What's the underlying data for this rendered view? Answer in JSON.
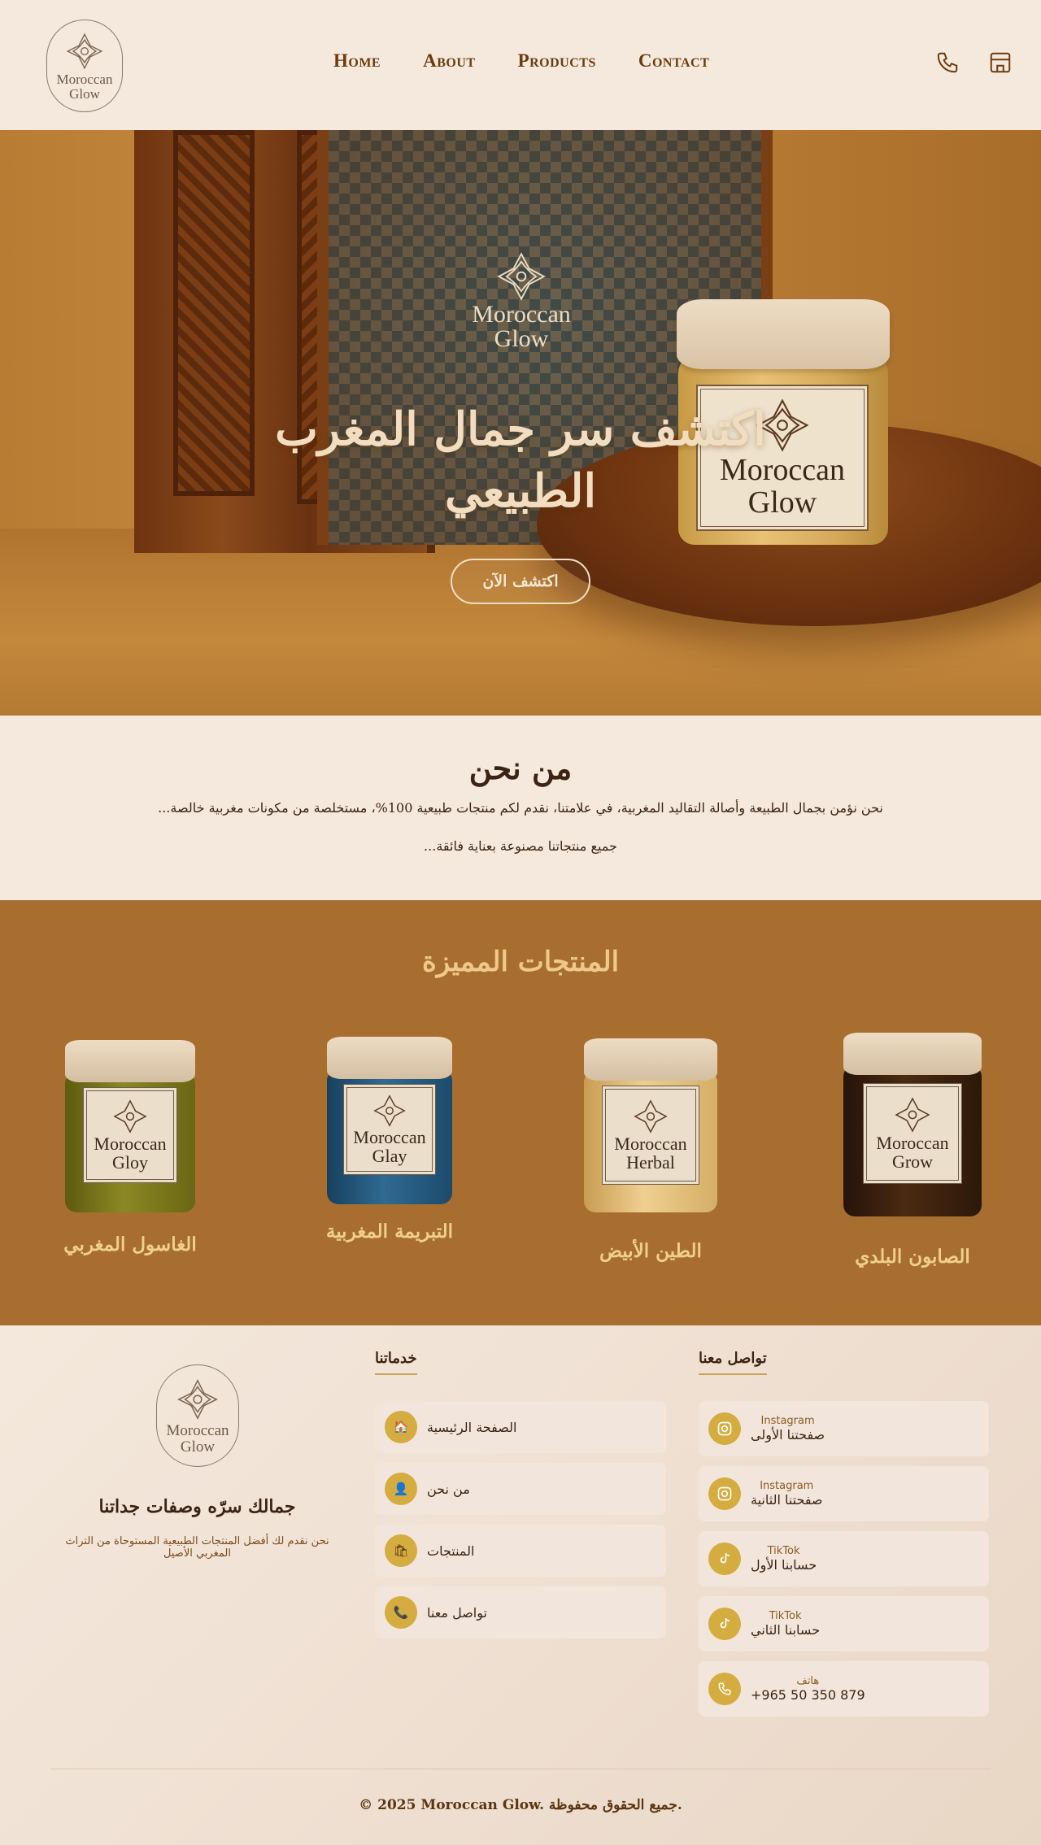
{
  "brand": {
    "name_line1": "Moroccan",
    "name_line2": "Glow"
  },
  "nav": {
    "items": [
      "Home",
      "About",
      "Products",
      "Contact"
    ]
  },
  "header_icons": [
    "phone-icon",
    "store-icon"
  ],
  "hero": {
    "logo_line1": "Moroccan",
    "logo_line2": "Glow",
    "jar_label_line1": "Moroccan",
    "jar_label_line2": "Glow",
    "title": "اكتشف سر جمال المغرب الطبيعي",
    "cta": "اكتشف الآن"
  },
  "about": {
    "title": "من نحن",
    "line1": "...نحن نؤمن بجمال الطبيعة وأصالة التقاليد المغربية، في علامتنا، نقدم لكم منتجات طبيعية 100%، مستخلصة من مكونات مغربية خالصة",
    "line2": "...جميع منتجاتنا مصنوعة بعناية فائقة"
  },
  "featured": {
    "title": "المنتجات المميزة",
    "products": [
      {
        "name": "الغاسول المغربي",
        "label1": "Moroccan",
        "label2": "Gloy",
        "color": "#7d7a1c"
      },
      {
        "name": "التبريمة المغربية",
        "label1": "Moroccan",
        "label2": "Glay",
        "color": "#245276"
      },
      {
        "name": "الطين الأبيض",
        "label1": "Moroccan",
        "label2": "Herbal",
        "color": "#e3c17e"
      },
      {
        "name": "الصابون البلدي",
        "label1": "Moroccan",
        "label2": "Grow",
        "color": "#3a1f0c"
      }
    ]
  },
  "footer": {
    "logo_line1": "Moroccan",
    "logo_line2": "Glow",
    "slogan": "جمالك سرّه وصفات جداتنا",
    "desc": "نحن نقدم لك أفضل المنتجات الطبيعية المستوحاة من التراث المغربي الأصيل",
    "services_title": "خدماتنا",
    "services": [
      {
        "label": "الصفحة الرئيسية",
        "icon": "home-icon",
        "glyph": "🏠"
      },
      {
        "label": "من نحن",
        "icon": "user-icon",
        "glyph": "👤"
      },
      {
        "label": "المنتجات",
        "icon": "bag-icon",
        "glyph": "🛍"
      },
      {
        "label": "تواصل معنا",
        "icon": "phone-icon",
        "glyph": "📞"
      }
    ],
    "contact_title": "تواصل معنا",
    "contacts": [
      {
        "small": "Instagram",
        "big": "صفحتنا الأولى",
        "icon": "instagram-icon"
      },
      {
        "small": "Instagram",
        "big": "صفحتنا الثانية",
        "icon": "instagram-icon"
      },
      {
        "small": "TikTok",
        "big": "حسابنا الأول",
        "icon": "tiktok-icon"
      },
      {
        "small": "TikTok",
        "big": "حسابنا الثاني",
        "icon": "tiktok-icon"
      },
      {
        "small": "هاتف",
        "big": "+965 50 350 879",
        "icon": "phone-icon"
      }
    ],
    "copyright": "© 2025 Moroccan Glow. جميع الحقوق محفوظة."
  },
  "colors": {
    "accent": "#d4ac3f",
    "brown": "#a86e2f",
    "cream": "#f5e8dc",
    "nav": "#6b3c0e"
  }
}
